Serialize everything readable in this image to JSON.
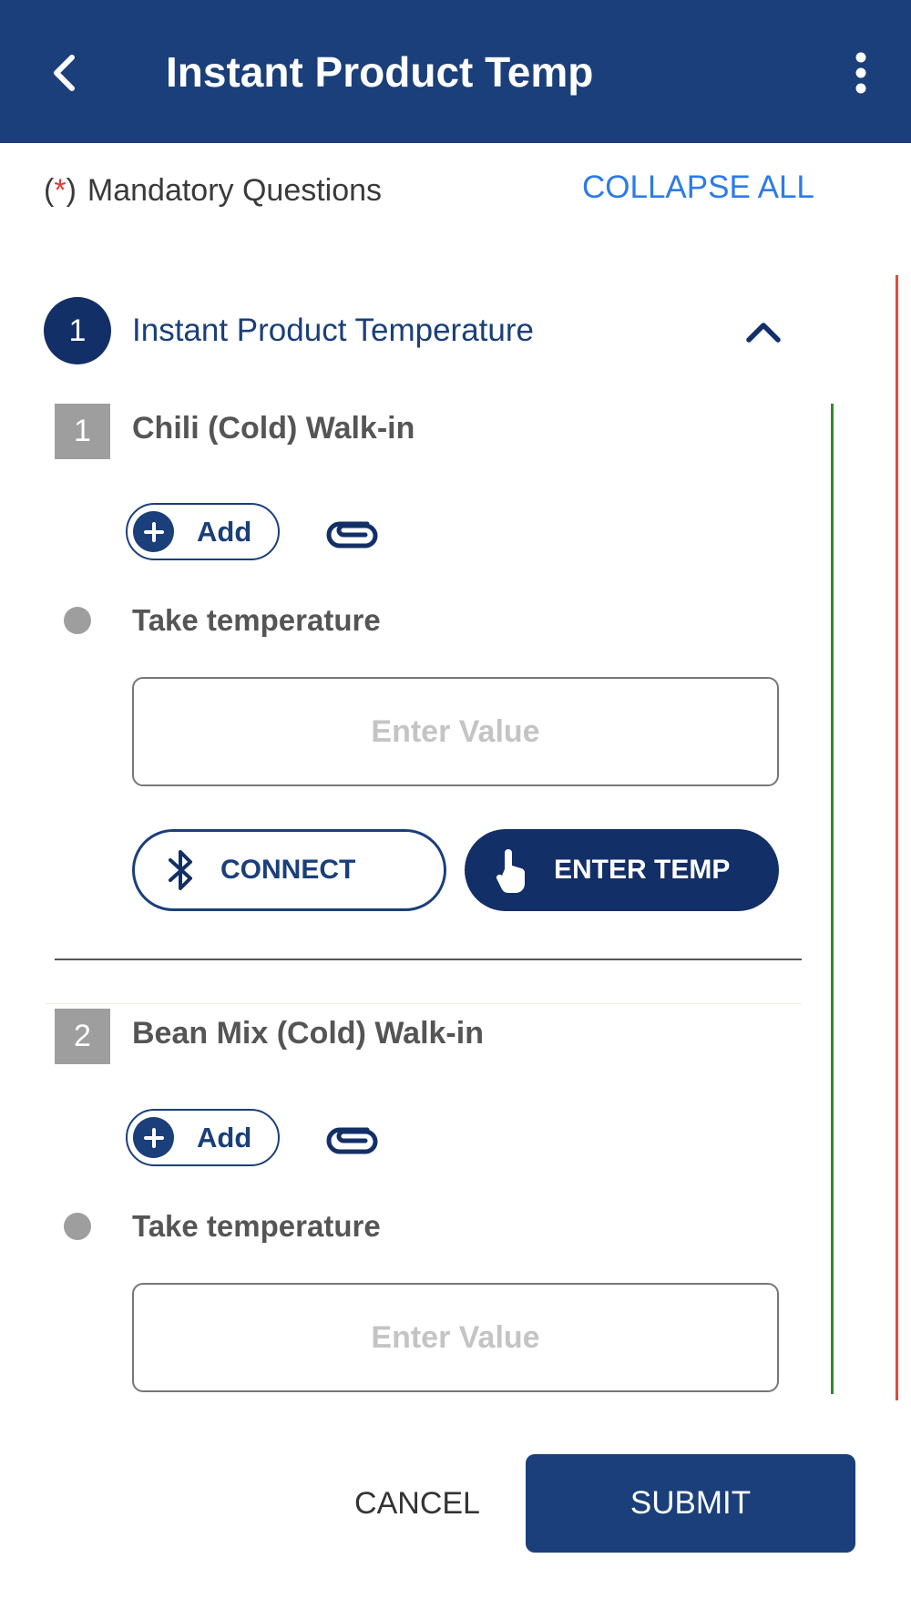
{
  "header": {
    "title": "Instant Product Temp",
    "back_icon": "chevron-left-icon",
    "menu_icon": "more-vertical-icon",
    "background_color": "#1a3f7a"
  },
  "mandatory": {
    "open_paren": "(",
    "star": "*",
    "close_paren": ")",
    "text": "Mandatory Questions"
  },
  "collapse_all_label": "COLLAPSE ALL",
  "section": {
    "number": "1",
    "title": "Instant Product Temperature",
    "toggle_icon": "chevron-up-icon"
  },
  "questions": [
    {
      "number": "1",
      "title": "Chili (Cold) Walk-in",
      "add_label": "Add",
      "prompt": "Take temperature",
      "input_placeholder": "Enter Value",
      "connect_label": "CONNECT",
      "enter_temp_label": "ENTER TEMP"
    },
    {
      "number": "2",
      "title": "Bean Mix (Cold) Walk-in",
      "add_label": "Add",
      "prompt": "Take temperature",
      "input_placeholder": "Enter Value"
    }
  ],
  "footer": {
    "cancel_label": "CANCEL",
    "submit_label": "SUBMIT"
  },
  "colors": {
    "primary": "#1a3f7a",
    "dark_primary": "#132f67",
    "link": "#2d7be6",
    "mandatory_star": "#e53935",
    "status_red": "#e24b3b",
    "status_green": "#2e8b2e"
  }
}
